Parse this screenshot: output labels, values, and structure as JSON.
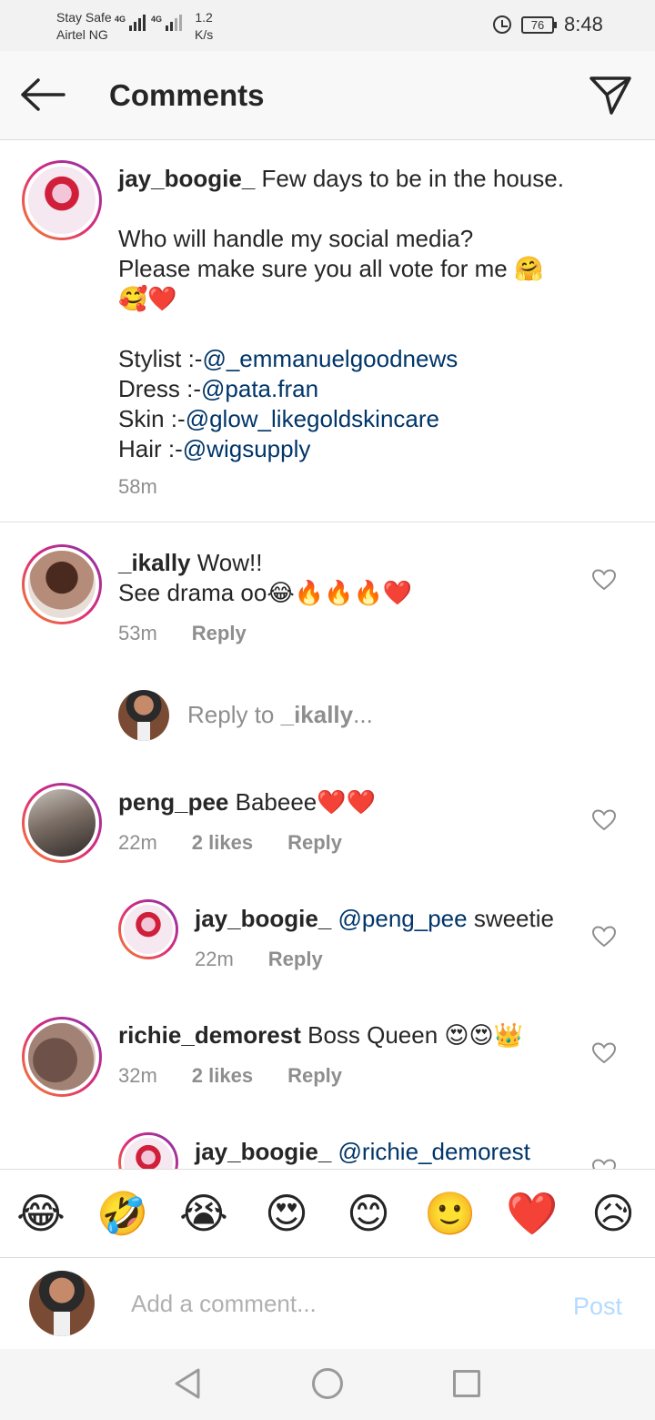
{
  "status": {
    "carrier_line1": "Stay Safe",
    "carrier_line2": "Airtel NG",
    "net_type1": "4G",
    "net_type2": "4G",
    "speed_value": "1.2",
    "speed_unit": "K/s",
    "battery": "76",
    "time": "8:48"
  },
  "header": {
    "title": "Comments"
  },
  "caption": {
    "username": "jay_boogie_",
    "line1": " Few days to be in the house.",
    "line2": "Who will handle my social media?",
    "line3": "Please make sure you all vote for me 🤗",
    "line4": "🥰❤️",
    "stylist_label": "Stylist :-",
    "stylist_handle": "@_emmanuelgoodnews",
    "dress_label": "Dress :-",
    "dress_handle": "@pata.fran",
    "skin_label": "Skin :-",
    "skin_handle": "@glow_likegoldskincare",
    "hair_label": "Hair :-",
    "hair_handle": "@wigsupply",
    "time": "58m"
  },
  "comments": [
    {
      "username": "_ikally",
      "text": " Wow!!",
      "text2": "See drama oo😂🔥🔥🔥❤️",
      "time": "53m",
      "reply": "Reply"
    },
    {
      "username": "peng_pee",
      "text": " Babeee❤️❤️",
      "time": "22m",
      "likes": "2 likes",
      "reply": "Reply"
    },
    {
      "username": "jay_boogie_",
      "mention": "@peng_pee",
      "text": " sweetie",
      "time": "22m",
      "reply": "Reply"
    },
    {
      "username": "richie_demorest",
      "text": " Boss Queen 😍😍👑",
      "time": "32m",
      "likes": "2 likes",
      "reply": "Reply"
    },
    {
      "username": "jay_boogie_",
      "mention": "@richie_demorest"
    }
  ],
  "reply_prompt": {
    "prefix": "Reply to ",
    "username": "_ikally",
    "suffix": "..."
  },
  "emoji_bar": [
    "😂",
    "🤣",
    "😭",
    "😍",
    "😊",
    "🙂",
    "❤️",
    "😥"
  ],
  "composer": {
    "placeholder": "Add a comment...",
    "post": "Post"
  }
}
